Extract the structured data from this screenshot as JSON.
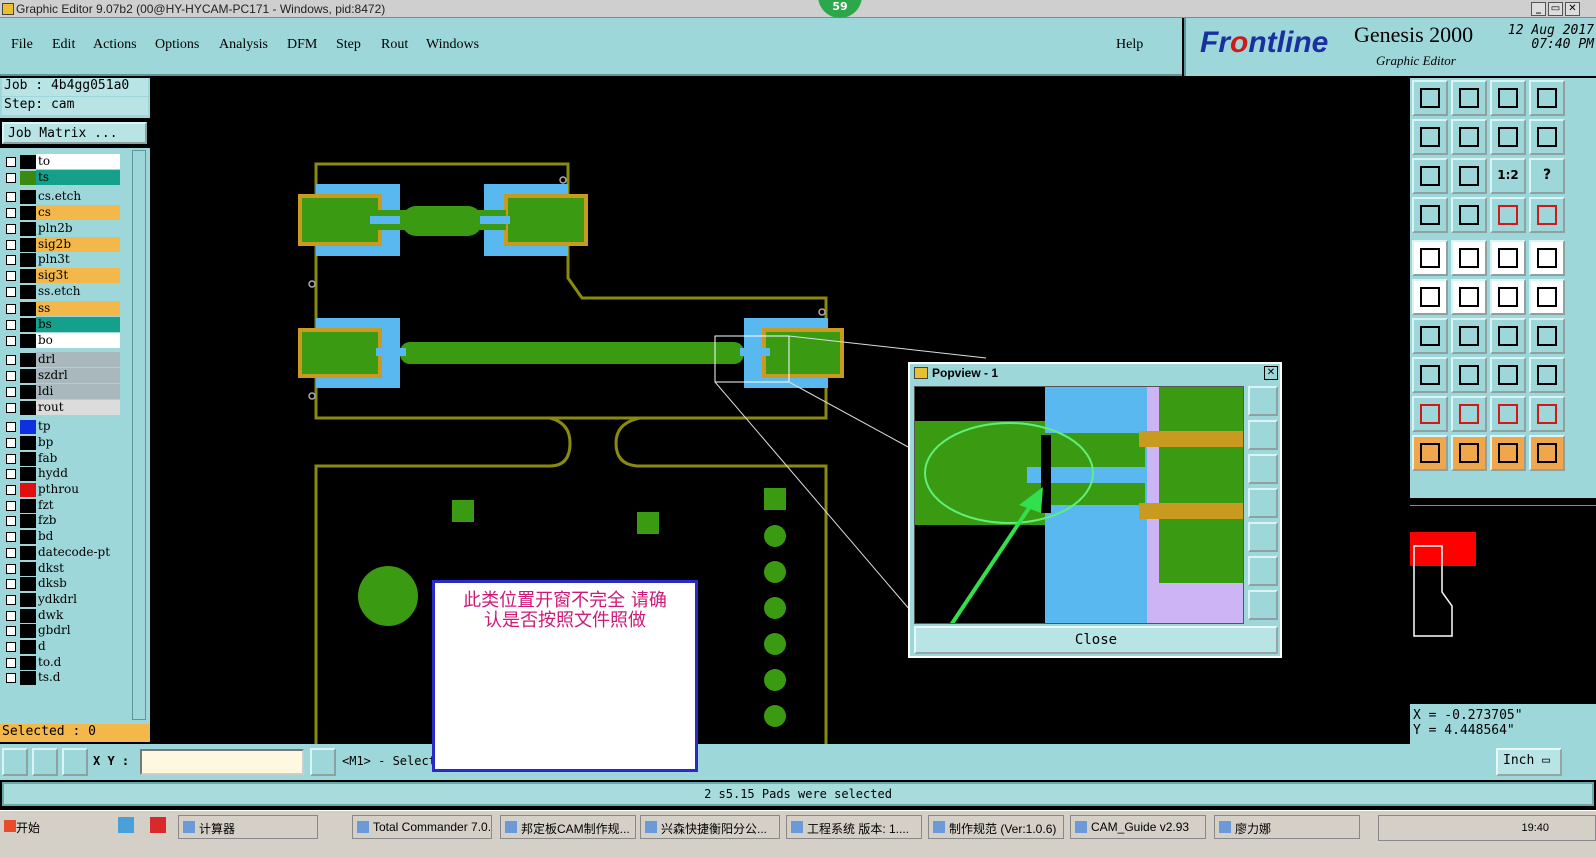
{
  "window": {
    "title": "Graphic Editor 9.07b2 (00@HY-HYCAM-PC171 - Windows, pid:8472)",
    "badge": "59"
  },
  "menu": {
    "items": [
      "File",
      "Edit",
      "Actions",
      "Options",
      "Analysis",
      "DFM",
      "Step",
      "Rout",
      "Windows"
    ],
    "help": "Help"
  },
  "brand": {
    "logo_pre": "Fr",
    "logo_o": "o",
    "logo_post": "ntline",
    "product": "Genesis 2000",
    "sub": "Graphic Editor",
    "date": "12 Aug 2017",
    "time": "07:40 PM"
  },
  "left": {
    "job": "Job : 4b4gg051a0",
    "step": "Step: cam",
    "job_matrix": "Job Matrix ...",
    "selected": "Selected : 0"
  },
  "layers": [
    {
      "name": "to",
      "color": "#ffffff",
      "swatch": "#000000"
    },
    {
      "name": "ts",
      "color": "#14a08a",
      "swatch": "#3a8a10"
    },
    {
      "name": "cs.etch",
      "color": "#9ed7d9",
      "swatch": "#000000"
    },
    {
      "name": "cs",
      "color": "#f3b74a",
      "swatch": "#000000"
    },
    {
      "name": "pln2b",
      "color": "#9ed7d9",
      "swatch": "#000000"
    },
    {
      "name": "sig2b",
      "color": "#f3b74a",
      "swatch": "#000000"
    },
    {
      "name": "pln3t",
      "color": "#9ed7d9",
      "swatch": "#000000"
    },
    {
      "name": "sig3t",
      "color": "#f3b74a",
      "swatch": "#000000"
    },
    {
      "name": "ss.etch",
      "color": "#9ed7d9",
      "swatch": "#000000"
    },
    {
      "name": "ss",
      "color": "#f3b74a",
      "swatch": "#000000"
    },
    {
      "name": "bs",
      "color": "#14a08a",
      "swatch": "#000000"
    },
    {
      "name": "bo",
      "color": "#ffffff",
      "swatch": "#000000"
    },
    {
      "name": "drl",
      "color": "#a8b8bc",
      "swatch": "#000000"
    },
    {
      "name": "szdrl",
      "color": "#a8b8bc",
      "swatch": "#000000"
    },
    {
      "name": "ldi",
      "color": "#a8b8bc",
      "swatch": "#000000"
    },
    {
      "name": "rout",
      "color": "#dcdcdc",
      "swatch": "#000000"
    },
    {
      "name": "tp",
      "color": "#9ed7d9",
      "swatch": "#1030e0"
    },
    {
      "name": "bp",
      "color": "#9ed7d9",
      "swatch": "#000000"
    },
    {
      "name": "fab",
      "color": "#9ed7d9",
      "swatch": "#000000"
    },
    {
      "name": "hydd",
      "color": "#9ed7d9",
      "swatch": "#000000"
    },
    {
      "name": "pthrou",
      "color": "#9ed7d9",
      "swatch": "#e01010"
    },
    {
      "name": "fzt",
      "color": "#9ed7d9",
      "swatch": "#000000"
    },
    {
      "name": "fzb",
      "color": "#9ed7d9",
      "swatch": "#000000"
    },
    {
      "name": "bd",
      "color": "#9ed7d9",
      "swatch": "#000000"
    },
    {
      "name": "datecode-pt",
      "color": "#9ed7d9",
      "swatch": "#000000"
    },
    {
      "name": "dkst",
      "color": "#9ed7d9",
      "swatch": "#000000"
    },
    {
      "name": "dksb",
      "color": "#9ed7d9",
      "swatch": "#000000"
    },
    {
      "name": "ydkdrl",
      "color": "#9ed7d9",
      "swatch": "#000000"
    },
    {
      "name": "dwk",
      "color": "#9ed7d9",
      "swatch": "#000000"
    },
    {
      "name": "gbdrl",
      "color": "#9ed7d9",
      "swatch": "#000000"
    },
    {
      "name": "d",
      "color": "#9ed7d9",
      "swatch": "#000000"
    },
    {
      "name": "to.d",
      "color": "#9ed7d9",
      "swatch": "#000000"
    },
    {
      "name": "ts.d",
      "color": "#9ed7d9",
      "swatch": "#000000"
    }
  ],
  "tools": {
    "ratio_label": "1:2",
    "help_label": "?"
  },
  "coords": {
    "x": "X = -0.273705\"",
    "y": "Y = 4.448564\""
  },
  "bottom": {
    "xy_label": "X Y :",
    "xy_value": "",
    "mode": "<M1> - Select",
    "units": "Inch"
  },
  "status": "2 s5.15 Pads were selected",
  "popview": {
    "title": "Popview - 1",
    "close": "Close"
  },
  "note": {
    "line1": "此类位置开窗不完全  请确",
    "line2": "认是否按照文件照做"
  },
  "taskbar": {
    "start": "开始",
    "tasks": [
      "计算器",
      "Total Commander 7.0...",
      "邦定板CAM制作规...",
      "兴森快捷衡阳分公...",
      "工程系统  版本: 1....",
      "制作规范 (Ver:1.0.6)",
      "CAM_Guide v2.93",
      "廖力娜"
    ],
    "clock": "19:40"
  },
  "colors": {
    "panel": "#9ed7d9",
    "green": "#3a9a12",
    "pad_blue": "#5ab8f0",
    "outline": "#8a8a10",
    "gold": "#c89a20"
  }
}
